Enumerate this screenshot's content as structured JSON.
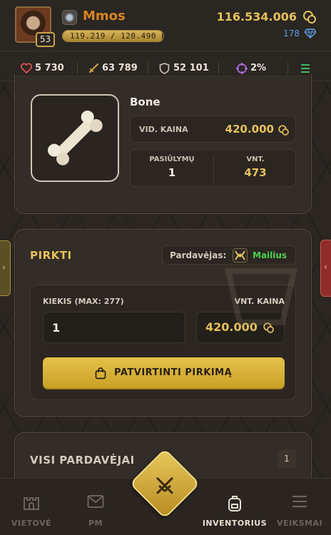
{
  "player": {
    "name": "Mmos",
    "level": "53",
    "xp_text": "119.219 / 120.490",
    "xp_fraction": 0.989,
    "gold": "116.534.006",
    "gems": "178"
  },
  "stats": {
    "health": "5 730",
    "attack": "63 789",
    "defense": "52 101",
    "crit": "2%"
  },
  "item": {
    "name": "Bone",
    "avg_price_label": "VID. KAINA",
    "avg_price": "420.000",
    "offers_label": "PASIŪLYMŲ",
    "offers": "1",
    "units_label": "VNT.",
    "units": "473"
  },
  "buy": {
    "title": "PIRKTI",
    "seller_label": "Pardavėjas:",
    "seller_name": "Mailius",
    "quantity_label": "KIEKIS (MAX: 277)",
    "quantity_value": "1",
    "unit_price_label": "VNT. KAINA",
    "unit_price": "420.000",
    "confirm_label": "PATVIRTINTI PIRKIMĄ"
  },
  "sellers": {
    "title": "VISI PARDAVĖJAI",
    "count": "1"
  },
  "nav": {
    "items": [
      {
        "label": "VIETOVĖ",
        "icon": "castle-icon"
      },
      {
        "label": "PM",
        "icon": "mail-icon"
      },
      {
        "label": "",
        "icon": "crossed-swords-icon"
      },
      {
        "label": "INVENTORIUS",
        "icon": "backpack-icon"
      },
      {
        "label": "VEIKSMAI",
        "icon": "menu-icon"
      }
    ]
  },
  "colors": {
    "accent_gold": "#e5c15a",
    "username_orange": "#d9831f",
    "seller_green": "#4cd04c",
    "gem_blue": "#5f9ee8"
  }
}
